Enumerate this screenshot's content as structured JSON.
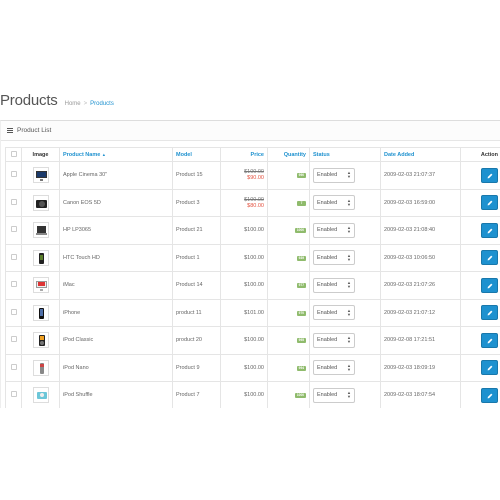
{
  "header": {
    "title": "Products",
    "breadcrumb": {
      "home": "Home",
      "separator": ">",
      "current": "Products"
    }
  },
  "panel": {
    "title": "Product List",
    "icon": "list-icon"
  },
  "table": {
    "columns": {
      "image": "Image",
      "name": "Product Name",
      "model": "Model",
      "price": "Price",
      "quantity": "Quantity",
      "status": "Status",
      "date_added": "Date Added",
      "action": "Action"
    },
    "sort_indicator": "▲",
    "rows": [
      {
        "name": "Apple Cinema 30\"",
        "model": "Product 15",
        "old_price": "$100.00",
        "price": "$90.00",
        "quantity": "990",
        "status": "Enabled",
        "date_added": "2009-02-03 21:07:37",
        "thumb": "monitor"
      },
      {
        "name": "Canon EOS 5D",
        "model": "Product 3",
        "old_price": "$100.00",
        "price": "$80.00",
        "quantity": "7",
        "status": "Enabled",
        "date_added": "2009-02-03 16:59:00",
        "thumb": "camera"
      },
      {
        "name": "HP LP3065",
        "model": "Product 21",
        "old_price": "",
        "price": "$100.00",
        "quantity": "1000",
        "status": "Enabled",
        "date_added": "2009-02-03 21:08:40",
        "thumb": "laptop"
      },
      {
        "name": "HTC Touch HD",
        "model": "Product 1",
        "old_price": "",
        "price": "$100.00",
        "quantity": "939",
        "status": "Enabled",
        "date_added": "2009-02-03 10:06:50",
        "thumb": "phone"
      },
      {
        "name": "iMac",
        "model": "Product 14",
        "old_price": "",
        "price": "$100.00",
        "quantity": "977",
        "status": "Enabled",
        "date_added": "2009-02-03 21:07:26",
        "thumb": "imac"
      },
      {
        "name": "iPhone",
        "model": "product 11",
        "old_price": "",
        "price": "$101.00",
        "quantity": "970",
        "status": "Enabled",
        "date_added": "2009-02-03 21:07:12",
        "thumb": "iphone"
      },
      {
        "name": "iPod Classic",
        "model": "product 20",
        "old_price": "",
        "price": "$100.00",
        "quantity": "995",
        "status": "Enabled",
        "date_added": "2009-02-08 17:21:51",
        "thumb": "ipod-classic"
      },
      {
        "name": "iPod Nano",
        "model": "Product 9",
        "old_price": "",
        "price": "$100.00",
        "quantity": "994",
        "status": "Enabled",
        "date_added": "2009-02-03 18:09:19",
        "thumb": "ipod-nano"
      },
      {
        "name": "iPod Shuffle",
        "model": "Product 7",
        "old_price": "",
        "price": "$100.00",
        "quantity": "1000",
        "status": "Enabled",
        "date_added": "2009-02-03 18:07:54",
        "thumb": "ipod-shuffle"
      }
    ]
  },
  "colors": {
    "accent": "#1e91cf",
    "special_price": "#e3503e",
    "quantity_badge": "#8fbb6c"
  },
  "icons": {
    "edit": "pencil-icon",
    "select": "chevron-down-icon"
  }
}
